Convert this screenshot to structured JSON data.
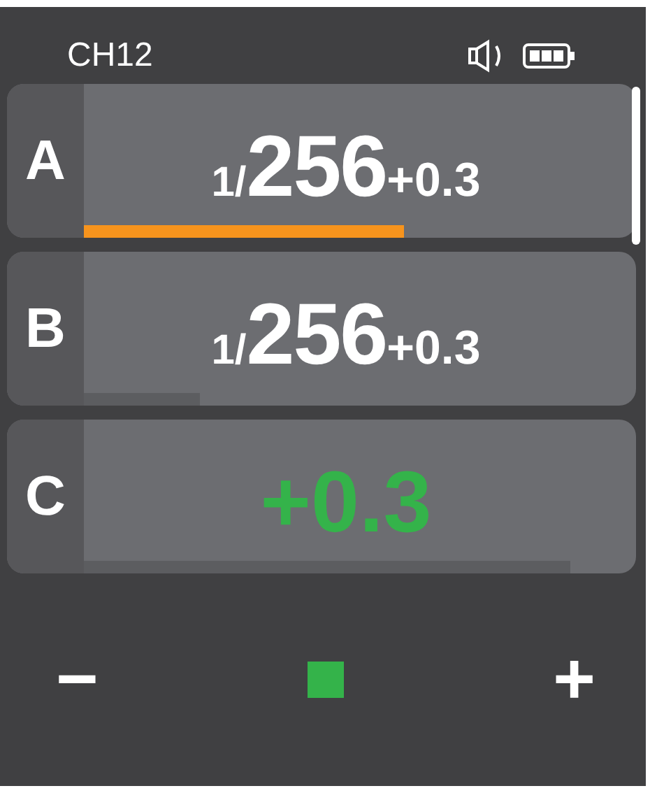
{
  "header": {
    "channel": "CH12"
  },
  "groups": [
    {
      "letter": "A",
      "kind": "manual",
      "prefix": "1/",
      "power": "256",
      "compensation": "+0.3",
      "selected": true
    },
    {
      "letter": "B",
      "kind": "manual",
      "prefix": "1/",
      "power": "256",
      "compensation": "+0.3",
      "selected": false
    },
    {
      "letter": "C",
      "kind": "ttl",
      "compensation": "+0.3",
      "selected": false
    }
  ],
  "controls": {
    "minus": "−",
    "plus": "+"
  }
}
